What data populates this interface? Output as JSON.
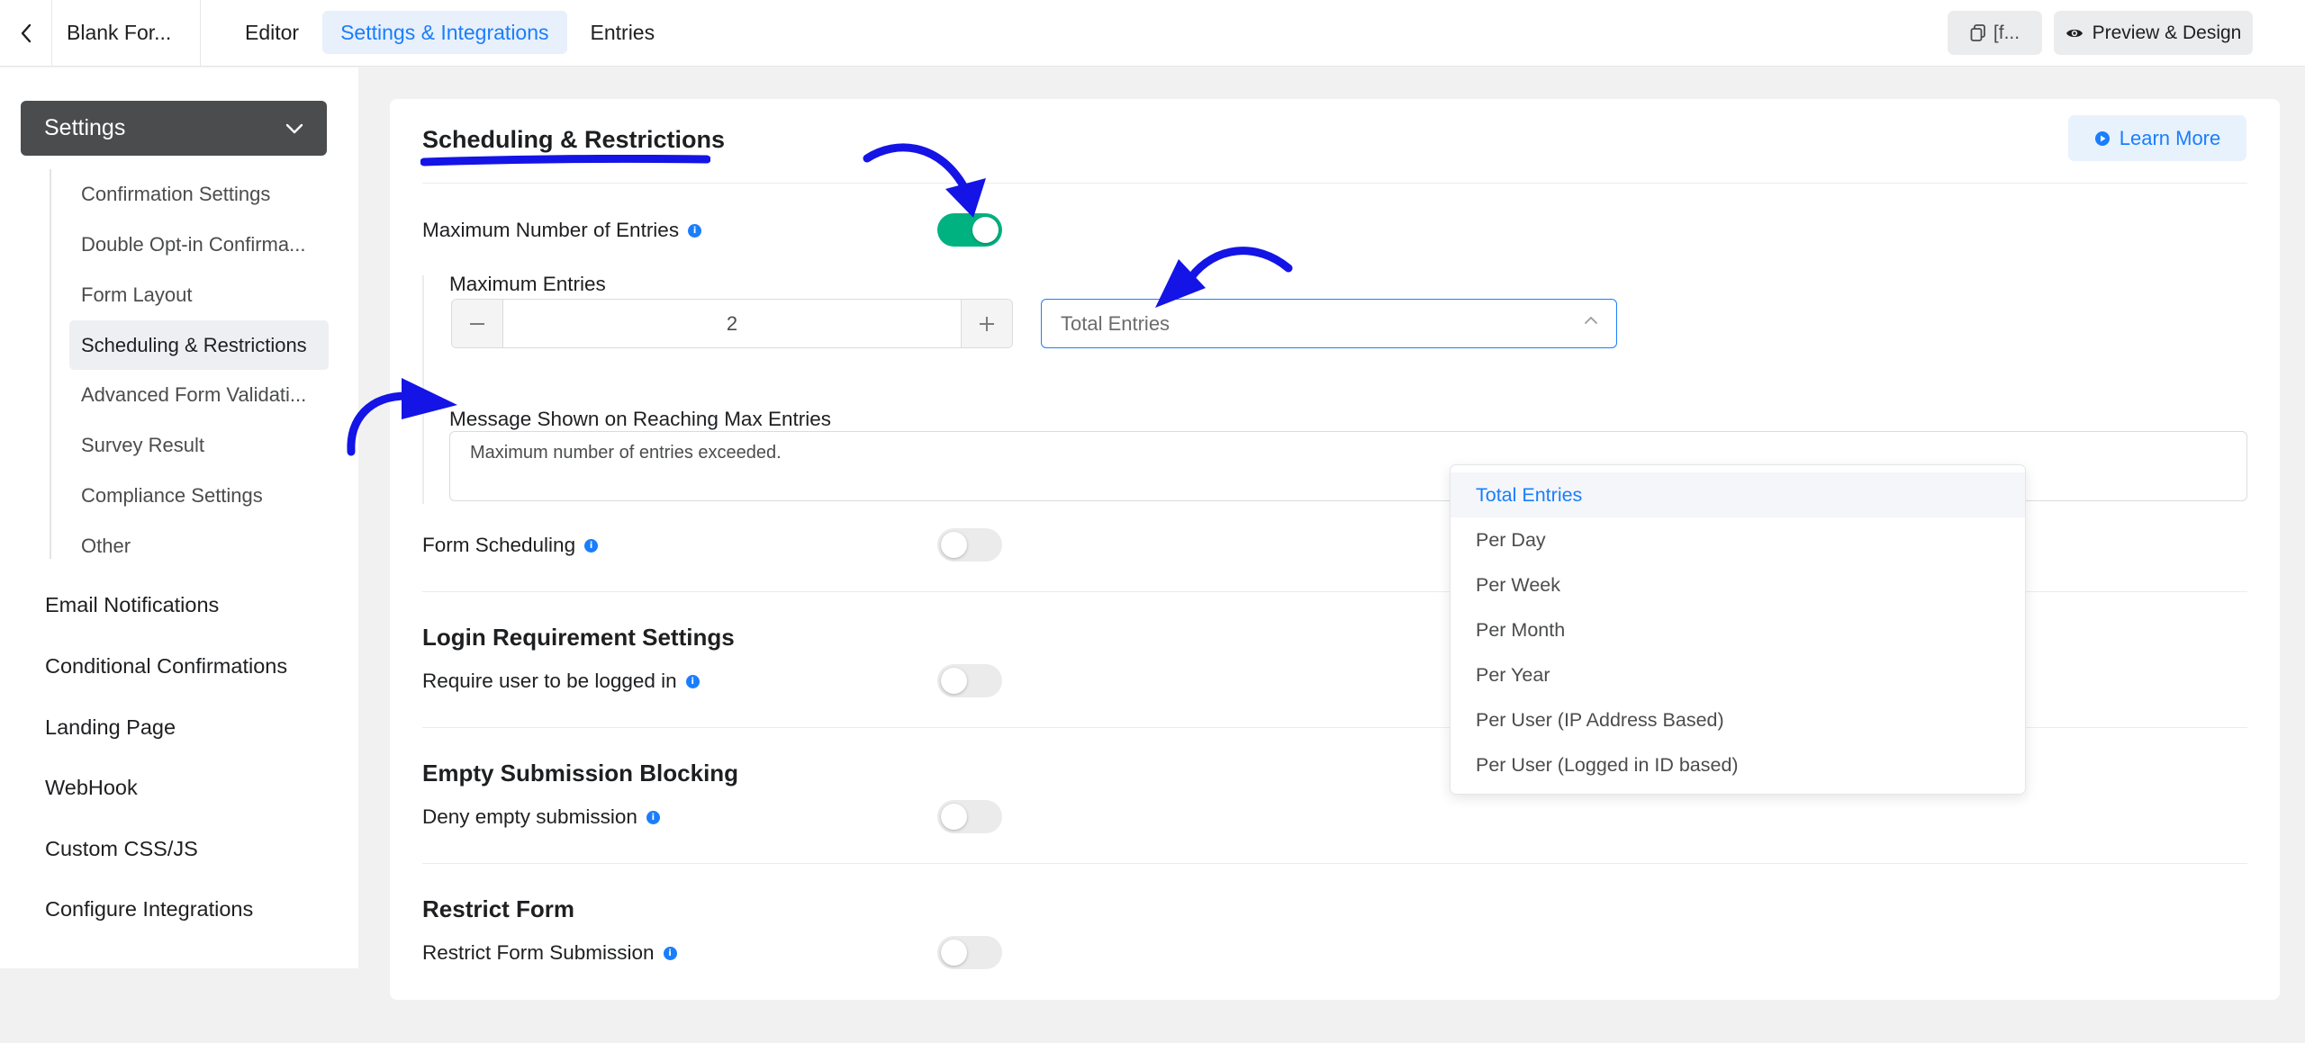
{
  "topbar": {
    "form_title": "Blank For...",
    "tabs": [
      {
        "label": "Editor",
        "active": false
      },
      {
        "label": "Settings & Integrations",
        "active": true
      },
      {
        "label": "Entries",
        "active": false
      }
    ],
    "shortcode_label": "[f...",
    "preview_label": "Preview & Design"
  },
  "sidebar": {
    "settings_label": "Settings",
    "sub_items": [
      {
        "label": "Confirmation Settings"
      },
      {
        "label": "Double Opt-in Confirma..."
      },
      {
        "label": "Form Layout"
      },
      {
        "label": "Scheduling & Restrictions",
        "active": true
      },
      {
        "label": "Advanced Form Validati..."
      },
      {
        "label": "Survey Result"
      },
      {
        "label": "Compliance Settings"
      },
      {
        "label": "Other"
      }
    ],
    "links": [
      {
        "label": "Email Notifications"
      },
      {
        "label": "Conditional Confirmations"
      },
      {
        "label": "Landing Page"
      },
      {
        "label": "WebHook"
      },
      {
        "label": "Custom CSS/JS"
      },
      {
        "label": "Configure Integrations"
      }
    ]
  },
  "main": {
    "title": "Scheduling & Restrictions",
    "learn_more": "Learn More",
    "max_entries": {
      "label": "Maximum Number of Entries",
      "enabled": true,
      "field_label": "Maximum Entries",
      "value": "2",
      "period_selected": "Total Entries",
      "message_label": "Message Shown on Reaching Max Entries",
      "message_value": "Maximum number of entries exceeded."
    },
    "form_scheduling": {
      "label": "Form Scheduling",
      "enabled": false
    },
    "login": {
      "section_title": "Login Requirement Settings",
      "label": "Require user to be logged in",
      "enabled": false
    },
    "empty": {
      "section_title": "Empty Submission Blocking",
      "label": "Deny empty submission",
      "enabled": false
    },
    "restrict": {
      "section_title": "Restrict Form",
      "label": "Restrict Form Submission",
      "enabled": false
    }
  },
  "dropdown": {
    "options": [
      "Total Entries",
      "Per Day",
      "Per Week",
      "Per Month",
      "Per Year",
      "Per User (IP Address Based)",
      "Per User (Logged in ID based)"
    ],
    "selected_index": 0
  },
  "colors": {
    "accent": "#1a7efb",
    "toggle_on": "#00b27f",
    "annotation": "#1414e6"
  }
}
